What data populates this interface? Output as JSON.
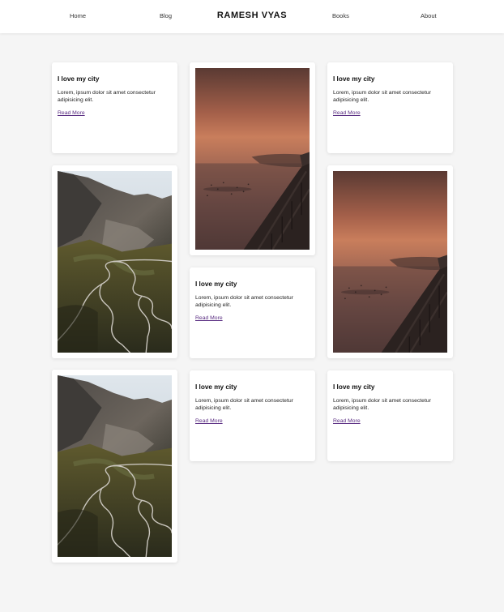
{
  "nav": {
    "home": "Home",
    "blog": "Blog",
    "brand": "RAMESH VYAS",
    "books": "Books",
    "about": "About"
  },
  "post": {
    "title": "I love my city",
    "body": "Lorem, ipsum dolor sit amet consectetur adipisicing elit.",
    "read_more": "Read More"
  },
  "images": {
    "mountain": "mountain-road-photo",
    "sunset": "misty-lake-pier-photo"
  },
  "colors": {
    "background": "#f5f5f5",
    "card": "#ffffff",
    "link": "#5a2d82"
  }
}
